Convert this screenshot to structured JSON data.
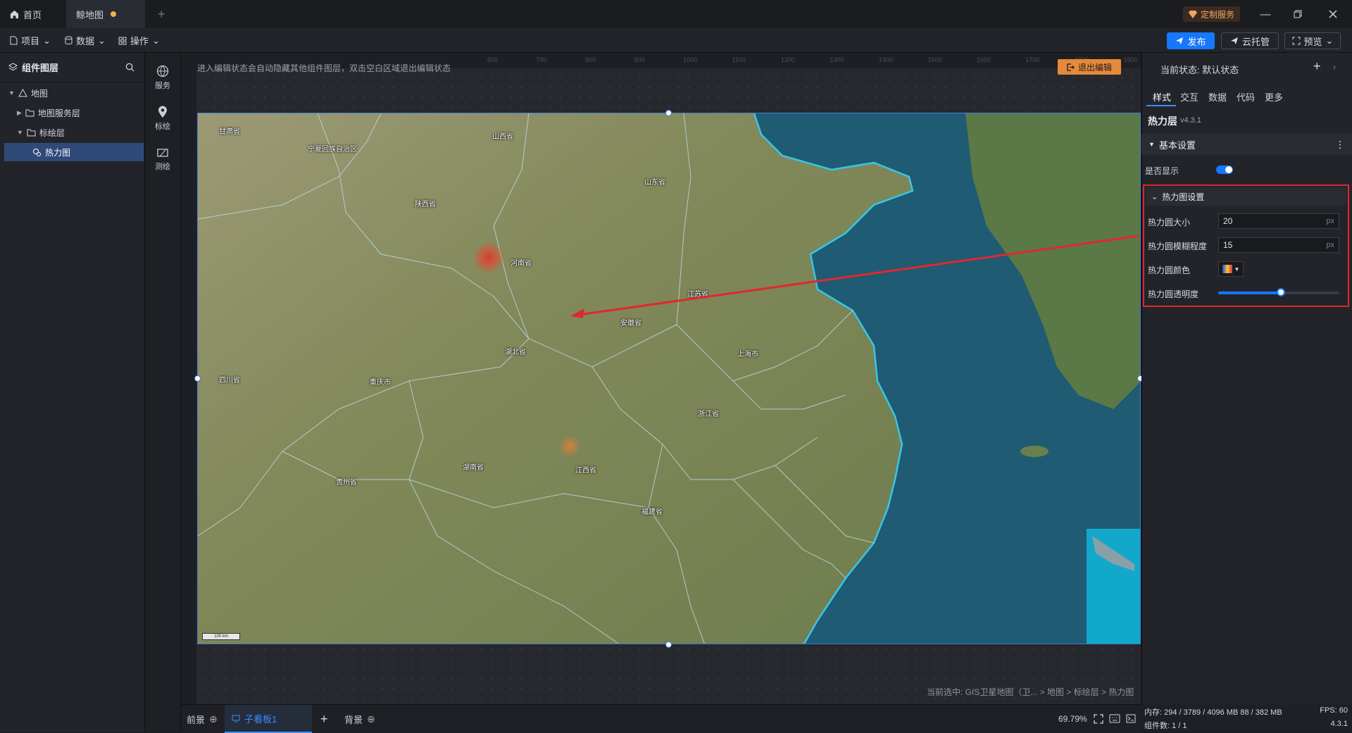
{
  "titlebar": {
    "tabs": [
      {
        "label": "首页",
        "icon": "home-icon"
      },
      {
        "label": "鲸地图",
        "icon": "",
        "modified": true
      }
    ],
    "custom_service": "定制服务"
  },
  "menubar": {
    "menus": [
      {
        "label": "项目",
        "icon": "file-icon"
      },
      {
        "label": "数据",
        "icon": "database-icon"
      },
      {
        "label": "操作",
        "icon": "grid-icon"
      }
    ],
    "publish": "发布",
    "cloud_host": "云托管",
    "preview": "预览"
  },
  "left_panel": {
    "title": "组件图层",
    "tree": [
      {
        "label": "地图",
        "level": 0,
        "expanded": true,
        "icon": "map-icon"
      },
      {
        "label": "地图服务层",
        "level": 1,
        "expanded": false,
        "icon": "folder-icon"
      },
      {
        "label": "标绘层",
        "level": 1,
        "expanded": true,
        "icon": "folder-icon"
      },
      {
        "label": "热力图",
        "level": 2,
        "selected": true,
        "icon": "heatmap-icon"
      }
    ]
  },
  "tool_column": [
    {
      "label": "服务",
      "icon": "globe-icon"
    },
    {
      "label": "标绘",
      "icon": "pin-icon"
    },
    {
      "label": "测绘",
      "icon": "ruler-icon"
    }
  ],
  "canvas": {
    "edit_hint": "进入编辑状态会自动隐藏其他组件图层，双击空白区域退出编辑状态",
    "exit_edit": "退出编辑",
    "ruler_ticks": [
      "600",
      "700",
      "800",
      "900",
      "1000",
      "1100",
      "1200",
      "1300",
      "1400",
      "1500",
      "1600",
      "1700",
      "1800",
      "1900"
    ],
    "map_labels": [
      "甘肃省",
      "宁夏回族自治区",
      "山西省",
      "陕西省",
      "山东省",
      "河南省",
      "江苏省",
      "安徽省",
      "湖北省",
      "上海市",
      "四川省",
      "重庆市",
      "浙江省",
      "湖南省",
      "江西省",
      "贵州省",
      "福建省"
    ],
    "scale_label": "100 km",
    "breadcrumb": "当前选中: GIS卫星地图（卫... > 地图 > 标绘层 > 热力图",
    "colors": {
      "land": "#7f8a5a",
      "sea": "#1f5b73",
      "boundary": "#bfe3f2",
      "coast": "#39c6e6",
      "arrow": "#e0282e"
    }
  },
  "bottom_bar": {
    "tabs": [
      "前景",
      "子看板1",
      "背景"
    ],
    "zoom": "69.79%"
  },
  "right_panel": {
    "current_state": "当前状态: 默认状态",
    "tabs": [
      "样式",
      "交互",
      "数据",
      "代码",
      "更多"
    ],
    "layer_name": "热力层",
    "layer_version": "v4.3.1",
    "basic_section": "基本设置",
    "show_label": "是否显示",
    "show_value": true,
    "heat_section": "热力图设置",
    "radius_label": "热力圆大小",
    "radius_value": "20",
    "blur_label": "热力圆模糊程度",
    "blur_value": "15",
    "unit": "px",
    "color_label": "热力圆颜色",
    "opacity_label": "热力圆透明度",
    "opacity_value": 0.52
  },
  "status": {
    "memory": "内存: 294 / 3789 / 4096 MB  88 / 382 MB",
    "fps": "FPS: 60",
    "components": "组件数: 1 / 1",
    "version": "4.3.1"
  }
}
